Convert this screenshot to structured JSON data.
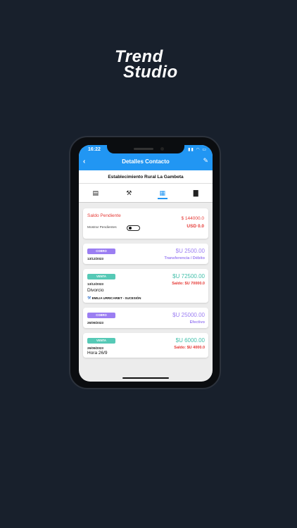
{
  "brand": {
    "line1": "Trend",
    "line2": "Studio"
  },
  "status": {
    "time": "16:22",
    "icons": "▮▮ ◠ ▭"
  },
  "appbar": {
    "title": "Detalles Contacto",
    "back_icon": "‹",
    "edit_icon": "✎"
  },
  "subheader": {
    "title": "Establecimiento Rural La Gambeta"
  },
  "tabs": [
    {
      "icon": "▤",
      "name": "notes"
    },
    {
      "icon": "⚒",
      "name": "legal"
    },
    {
      "icon": "▦",
      "name": "document"
    },
    {
      "icon": "▇",
      "name": "folder"
    }
  ],
  "saldo": {
    "label": "Saldo Pendiente",
    "amount_1": "$ 144000.0",
    "amount_2": "USD 0.0",
    "toggle_label": "Mostrar Pendientes"
  },
  "transactions": [
    {
      "type": "COBRO",
      "date": "13/12/2023",
      "amount": "$U 2500.00",
      "sub": "Transferencia / Débito"
    },
    {
      "type": "VENTA",
      "date": "13/12/2023",
      "amount": "$U 72500.00",
      "sub": "Saldo: $U 70000.0",
      "description": "Divorcio",
      "person": "EMILIA URRICARIET - SUCESIÓN",
      "person_icon": "⚒"
    },
    {
      "type": "COBRO",
      "date": "26/09/2023",
      "amount": "$U 25000.00",
      "sub": "Efectivo"
    },
    {
      "type": "VENTA",
      "date": "26/09/2023",
      "amount": "$U 6000.00",
      "sub": "Saldo: $U 4000.0",
      "description": "Hora  26/9"
    }
  ],
  "colors": {
    "accent": "#2196f3",
    "background": "#18202c",
    "cobro": "#9b7ef2",
    "venta": "#56c9b6",
    "negative": "#e53935"
  }
}
